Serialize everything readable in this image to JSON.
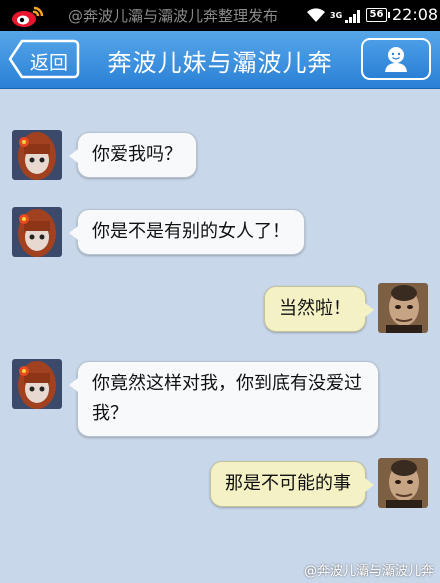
{
  "status_bar": {
    "watermark": "@奔波儿灞与灞波儿奔整理发布",
    "network": "3G",
    "battery": "56",
    "time": "22:08",
    "icons": [
      "weibo-logo",
      "wifi-icon",
      "signal-icon",
      "battery-icon"
    ]
  },
  "header": {
    "back_label": "返回",
    "title": "奔波儿妹与灞波儿奔",
    "profile_icon": "person-icon"
  },
  "messages": [
    {
      "side": "left",
      "sender": "girl",
      "text": "你爱我吗？"
    },
    {
      "side": "left",
      "sender": "girl",
      "text": "你是不是有别的女人了！"
    },
    {
      "side": "right",
      "sender": "monster",
      "text": "当然啦！"
    },
    {
      "side": "left",
      "sender": "girl",
      "text": "你竟然这样对我，你到底有没爱过我？"
    },
    {
      "side": "right",
      "sender": "monster",
      "text": "那是不可能的事"
    }
  ],
  "footer": {
    "watermark": "@奔波儿灞与灞波儿奔"
  },
  "colors": {
    "background": "#c8d7ea",
    "header": "#3a8fdf",
    "left_bubble": "#f7f9fb",
    "right_bubble": "#f4f1c4"
  }
}
